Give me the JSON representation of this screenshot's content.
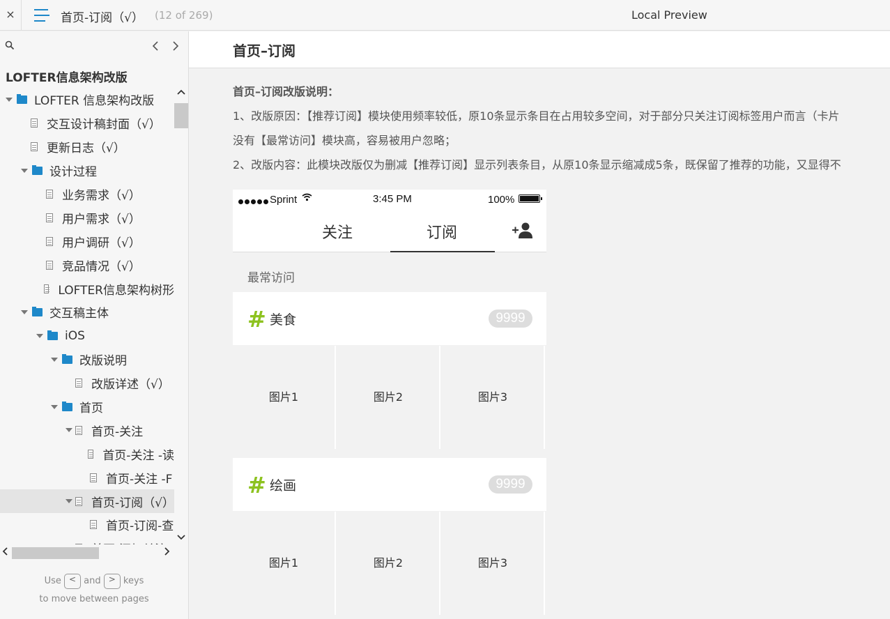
{
  "topbar": {
    "close": "×",
    "title": "首页-订阅（√）",
    "count": "(12 of 269)",
    "preview": "Local Preview"
  },
  "sidebar": {
    "project_title": "LOFTER信息架构改版",
    "tree": [
      {
        "label": "LOFTER 信息架构改版",
        "type": "folder",
        "level": 0,
        "open": true
      },
      {
        "label": "交互设计稿封面（√）",
        "type": "doc",
        "level": 1
      },
      {
        "label": "更新日志（√）",
        "type": "doc",
        "level": 1
      },
      {
        "label": "设计过程",
        "type": "folder",
        "level": 1,
        "open": true
      },
      {
        "label": "业务需求（√）",
        "type": "doc",
        "level": 2
      },
      {
        "label": "用户需求（√）",
        "type": "doc",
        "level": 2
      },
      {
        "label": "用户调研（√）",
        "type": "doc",
        "level": 2
      },
      {
        "label": "竞品情况（√）",
        "type": "doc",
        "level": 2
      },
      {
        "label": "LOFTER信息架构树形",
        "type": "doc",
        "level": 2
      },
      {
        "label": "交互稿主体",
        "type": "folder",
        "level": 1,
        "open": true
      },
      {
        "label": "iOS",
        "type": "folder",
        "level": 2,
        "open": true
      },
      {
        "label": "改版说明",
        "type": "folder",
        "level": 3,
        "open": true
      },
      {
        "label": "改版详述（√）",
        "type": "doc",
        "level": 4
      },
      {
        "label": "首页",
        "type": "folder",
        "level": 3,
        "open": true
      },
      {
        "label": "首页-关注",
        "type": "doc",
        "level": 4,
        "open": true
      },
      {
        "label": "首页-关注 -读",
        "type": "doc",
        "level": 5
      },
      {
        "label": "首页-关注 -F",
        "type": "doc",
        "level": 5
      },
      {
        "label": "首页-订阅（√）",
        "type": "doc",
        "level": 4,
        "open": true,
        "selected": true
      },
      {
        "label": "首页-订阅-查",
        "type": "doc",
        "level": 5
      },
      {
        "label": "首页-添加关注",
        "type": "doc",
        "level": 4
      }
    ],
    "help_use": "Use",
    "help_and": "and",
    "help_keys": "keys",
    "help_line2": "to move between pages",
    "key_prev": "<",
    "key_next": ">"
  },
  "main": {
    "title": "首页–订阅",
    "desc_title": "首页–订阅改版说明：",
    "desc_lines": [
      "1、改版原因：【推荐订阅】模块使用频率较低，原10条显示条目在占用较多空间，对于部分只关注订阅标签用户而言（卡片",
      "没有【最常访问】模块高，容易被用户忽略；",
      "2、改版内容：此模块改版仅为删减【推荐订阅】显示列表条目，从原10条显示缩减成5条，既保留了推荐的功能，又显得不"
    ],
    "phone": {
      "carrier": "Sprint",
      "time": "3:45 PM",
      "battery": "100%",
      "tab_follow": "关注",
      "tab_subscribe": "订阅",
      "section_title": "最常访问",
      "hash": "#",
      "tags": [
        {
          "name": "美食",
          "count": "9999",
          "images": [
            "图片1",
            "图片2",
            "图片3"
          ]
        },
        {
          "name": "绘画",
          "count": "9999",
          "images": [
            "图片1",
            "图片2",
            "图片3"
          ]
        }
      ]
    }
  }
}
